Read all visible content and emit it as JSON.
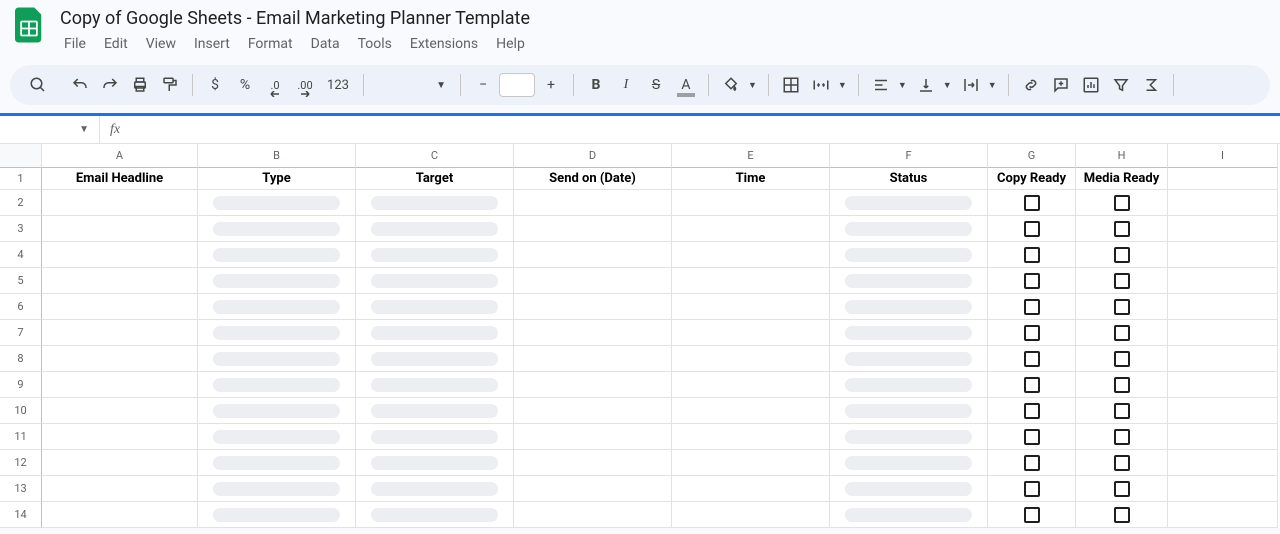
{
  "header": {
    "doc_title": "Copy of Google Sheets - Email Marketing Planner Template",
    "menu": [
      "File",
      "Edit",
      "View",
      "Insert",
      "Format",
      "Data",
      "Tools",
      "Extensions",
      "Help"
    ]
  },
  "toolbar": {
    "currency": "$",
    "percent": "%",
    "decrease_decimal": ".0",
    "increase_decimal": ".00",
    "more_formats": "123",
    "minus": "−",
    "plus": "+",
    "bold": "B",
    "italic": "I",
    "strike": "S",
    "text_color": "A"
  },
  "columns": [
    {
      "letter": "A",
      "width_class": "col-A"
    },
    {
      "letter": "B",
      "width_class": "col-B"
    },
    {
      "letter": "C",
      "width_class": "col-C"
    },
    {
      "letter": "D",
      "width_class": "col-D"
    },
    {
      "letter": "E",
      "width_class": "col-E"
    },
    {
      "letter": "F",
      "width_class": "col-F"
    },
    {
      "letter": "G",
      "width_class": "col-G"
    },
    {
      "letter": "H",
      "width_class": "col-H"
    },
    {
      "letter": "I",
      "width_class": "col-I"
    }
  ],
  "header_row": [
    "Email Headline",
    "Type",
    "Target",
    "Send on (Date)",
    "Time",
    "Status",
    "Copy Ready",
    "Media Ready",
    ""
  ],
  "data_row_count": 13,
  "chip_columns": [
    1,
    2,
    5
  ],
  "checkbox_columns": [
    6,
    7
  ]
}
